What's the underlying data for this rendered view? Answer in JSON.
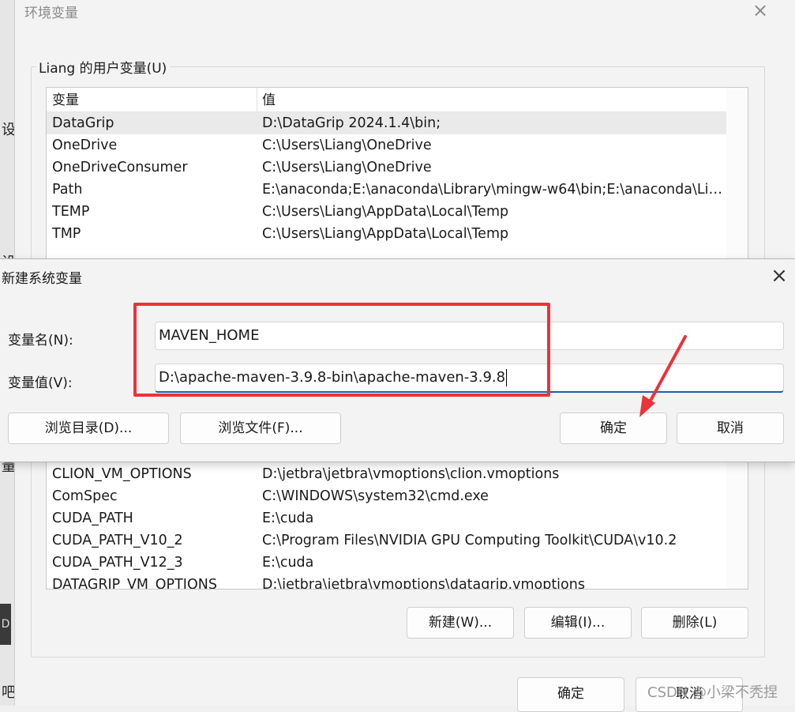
{
  "background": {
    "left_fragments": [
      "设",
      "设",
      "量",
      "D",
      "吧"
    ]
  },
  "env_window": {
    "title": "环境变量",
    "close_icon": "×",
    "user_group_label": "Liang 的用户变量(U)",
    "user_columns": [
      "变量",
      "值"
    ],
    "user_vars": [
      {
        "name": "DataGrip",
        "value": "D:\\DataGrip 2024.1.4\\bin;"
      },
      {
        "name": "OneDrive",
        "value": "C:\\Users\\Liang\\OneDrive"
      },
      {
        "name": "OneDriveConsumer",
        "value": "C:\\Users\\Liang\\OneDrive"
      },
      {
        "name": "Path",
        "value": "E:\\anaconda;E:\\anaconda\\Library\\mingw-w64\\bin;E:\\anaconda\\Lib..."
      },
      {
        "name": "TEMP",
        "value": "C:\\Users\\Liang\\AppData\\Local\\Temp"
      },
      {
        "name": "TMP",
        "value": "C:\\Users\\Liang\\AppData\\Local\\Temp"
      }
    ],
    "sys_vars": [
      {
        "name": "CLION_VM_OPTIONS",
        "value": "D:\\jetbra\\jetbra\\vmoptions\\clion.vmoptions"
      },
      {
        "name": "ComSpec",
        "value": "C:\\WINDOWS\\system32\\cmd.exe"
      },
      {
        "name": "CUDA_PATH",
        "value": "E:\\cuda"
      },
      {
        "name": "CUDA_PATH_V10_2",
        "value": "C:\\Program Files\\NVIDIA GPU Computing Toolkit\\CUDA\\v10.2"
      },
      {
        "name": "CUDA_PATH_V12_3",
        "value": "E:\\cuda"
      },
      {
        "name": "DATAGRIP_VM_OPTIONS",
        "value": "D:\\jetbra\\jetbra\\vmoptions\\datagrip.vmoptions"
      }
    ],
    "buttons": {
      "new": "新建(W)...",
      "edit": "编辑(I)...",
      "delete": "删除(L)",
      "ok": "确定",
      "cancel": "取消"
    }
  },
  "dialog": {
    "title": "新建系统变量",
    "close_icon": "×",
    "name_label": "变量名(N):",
    "value_label": "变量值(V):",
    "name_value": "MAVEN_HOME",
    "value_value": "D:\\apache-maven-3.9.8-bin\\apache-maven-3.9.8",
    "buttons": {
      "browse_dir": "浏览目录(D)...",
      "browse_file": "浏览文件(F)...",
      "ok": "确定",
      "cancel": "取消"
    }
  },
  "annotation": {
    "highlight_color": "#e8343a"
  },
  "watermark": "CSDN @小梁不秃捏"
}
